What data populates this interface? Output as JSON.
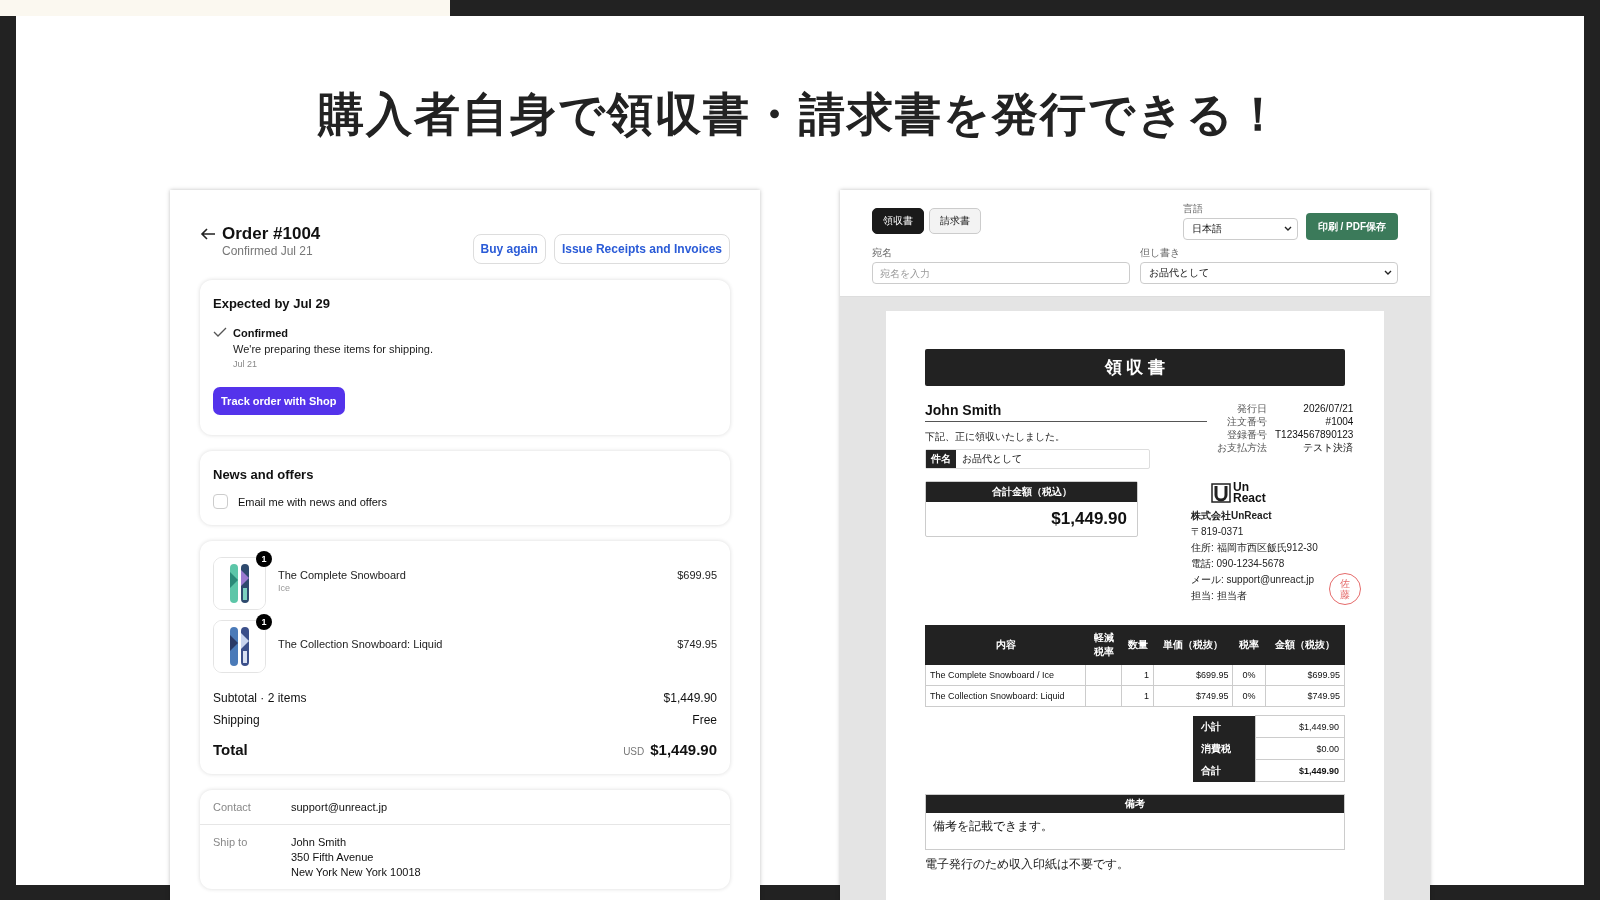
{
  "headline": "購入者自身で領収書・請求書を発行できる！",
  "order_page": {
    "title": "Order #1004",
    "subtitle": "Confirmed Jul 21",
    "buttons": [
      "Buy again",
      "Issue Receipts and Invoices"
    ],
    "status_card": {
      "heading": "Expected by Jul 29",
      "steps": [
        {
          "title": "Confirmed",
          "text": "We're preparing these items for shipping.",
          "date": "Jul 21",
          "done": true
        }
      ],
      "button": "Track order with Shop"
    },
    "news_card": {
      "heading": "News and offers",
      "checkbox": {
        "label": "Email me with news and offers",
        "checked": false
      }
    },
    "items": [
      {
        "name": "The Complete Snowboard",
        "variant": "Ice",
        "price": "$699.95",
        "quantity": "1",
        "kind": "picture"
      },
      {
        "name": "The Collection Snowboard: Liquid",
        "price": "$749.95",
        "quantity": "1",
        "kind": "picture"
      }
    ],
    "summary": [
      {
        "label": "Subtotal · 2 items",
        "value": "$1,449.90"
      },
      {
        "label": "Shipping",
        "value": "Free"
      }
    ],
    "total": {
      "label": "Total",
      "currency": "USD",
      "value": "$1,449.90"
    },
    "details": [
      {
        "label": "Contact",
        "lines": [
          "support@unreact.jp"
        ]
      },
      {
        "label": "Ship to",
        "lines": [
          "John Smith",
          "350 Fifth Avenue",
          "New York New York 10018"
        ]
      }
    ]
  },
  "receipt_tool": {
    "tabs": [
      {
        "label": "領収書",
        "selected": true
      },
      {
        "label": "請求書",
        "selected": false
      }
    ],
    "language": {
      "label": "言語",
      "value": "日本語"
    },
    "print_button": "印刷 / PDF保存",
    "recipient": {
      "label": "宛名",
      "placeholder": "宛名を入力"
    },
    "proviso": {
      "label": "但し書き",
      "value": "お品代として"
    },
    "document": {
      "title": "領 収 書",
      "recipient": "John Smith",
      "statement": "下記、正に領収いたしました。",
      "subject": {
        "label": "件名",
        "value": "お品代として"
      },
      "amount": {
        "label": "合計金額（税込）",
        "value": "$1,449.90"
      },
      "meta": [
        {
          "label": "発行日",
          "value": "2026/07/21"
        },
        {
          "label": "注文番号",
          "value": "#1004"
        },
        {
          "label": "登録番号",
          "value": "T1234567890123"
        },
        {
          "label": "お支払方法",
          "value": "テスト決済"
        }
      ],
      "logo": [
        "Un",
        "React"
      ],
      "company": "株式会社UnReact",
      "company_lines": [
        "〒819-0371",
        "住所: 福岡市西区飯氏912-30",
        "電話: 090-1234-5678",
        "メール: support@unreact.jp",
        "担当: 担当者"
      ],
      "seal": "佐藤",
      "table": {
        "columns": [
          "内容",
          "軽減税率",
          "数量",
          "単価（税抜）",
          "税率",
          "金額（税抜）"
        ],
        "rows": [
          {
            "description": "The Complete Snowboard / Ice",
            "quantity": "1",
            "unit_price": "$699.95",
            "tax_rate": "0%",
            "amount": "$699.95"
          },
          {
            "description": "The Collection Snowboard: Liquid",
            "quantity": "1",
            "unit_price": "$749.95",
            "tax_rate": "0%",
            "amount": "$749.95"
          }
        ]
      },
      "totals": [
        {
          "label": "小計",
          "value": "$1,449.90",
          "emphasized": false
        },
        {
          "label": "消費税",
          "value": "$0.00",
          "emphasized": false
        },
        {
          "label": "合計",
          "value": "$1,449.90",
          "emphasized": true
        }
      ],
      "notes": {
        "label": "備考",
        "text": "備考を記載できます。"
      },
      "footnote": "電子発行のため収入印紙は不要です。"
    }
  }
}
